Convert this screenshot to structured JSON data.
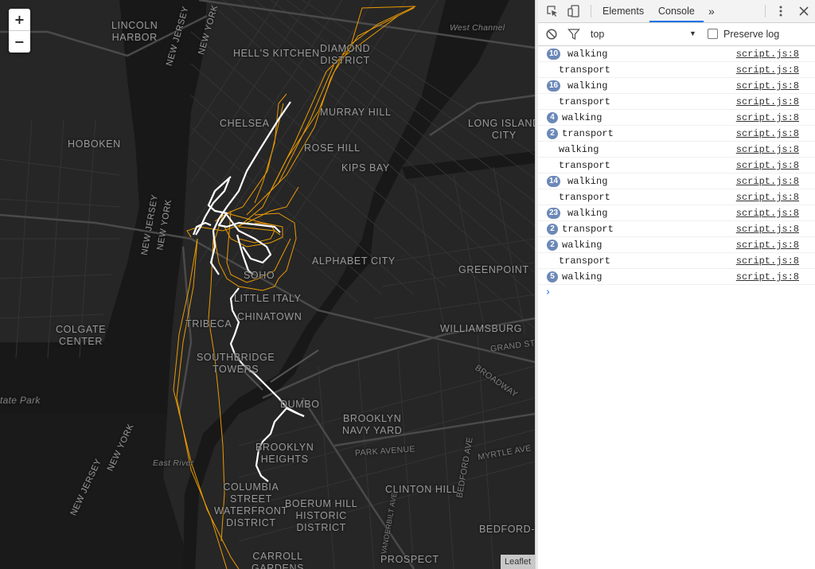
{
  "map": {
    "zoom_in": "+",
    "zoom_out": "−",
    "attribution": "Leaflet",
    "labels": {
      "lincoln_harbor": "LINCOLN\nHARBOR",
      "hells_kitchen": "HELL'S KITCHEN",
      "diamond_district": "DIAMOND\nDISTRICT",
      "murray_hill": "MURRAY HILL",
      "chelsea": "CHELSEA",
      "hoboken": "HOBOKEN",
      "rose_hill": "ROSE HILL",
      "kips_bay": "KIPS BAY",
      "long_island_city": "LONG ISLAND\nCITY",
      "alphabet_city": "ALPHABET CITY",
      "greenpoint": "GREENPOINT",
      "soho": "SOHO",
      "little_italy": "LITTLE ITALY",
      "tribeca": "TRIBECA",
      "chinatown": "CHINATOWN",
      "colgate_center": "COLGATE\nCENTER",
      "williamsburg": "WILLIAMSBURG",
      "southbridge_towers": "SOUTHBRIDGE\nTOWERS",
      "dumbo": "DUMBO",
      "brooklyn_navy_yard": "BROOKLYN\nNAVY YARD",
      "brooklyn_heights": "BROOKLYN\nHEIGHTS",
      "clinton_hill": "CLINTON HILL",
      "columbia_street": "COLUMBIA\nSTREET\nWATERFRONT\nDISTRICT",
      "boerum_hill": "BOERUM HILL\nHISTORIC\nDISTRICT",
      "bedford_s": "BEDFORD-S",
      "carroll_gardens": "CARROLL\nGARDENS",
      "prospect": "PROSPECT",
      "state_park": "tate Park",
      "east_river": "East River",
      "west_channel": "West Channel",
      "new_jersey_1": "NEW JERSEY",
      "new_york_1": "NEW YORK",
      "new_jersey_2": "NEW JERSEY",
      "new_york_2": "NEW YORK",
      "new_jersey_3": "NEW JERSEY",
      "new_york_3": "NEW YORK",
      "grand_st": "GRAND ST",
      "broadway": "BROADWAY",
      "park_avenue": "PARK AVENUE",
      "myrtle_ave": "MYRTLE AVE",
      "bedford_ave": "BEDFORD AVE",
      "vanderbilt": "VANDERBILT AVE"
    },
    "colors": {
      "walking": "#ffffff",
      "transport": "#f5a100",
      "background": "#262626",
      "streets": "#3a3a3a"
    }
  },
  "devtools": {
    "tabs": [
      "Elements",
      "Console"
    ],
    "active_tab": "Console",
    "more_tabs": "»",
    "context": "top",
    "preserve_log": "Preserve log",
    "logs": [
      {
        "count": "10",
        "text": "walking",
        "source": "script.js:8"
      },
      {
        "count": "",
        "text": "transport",
        "source": "script.js:8"
      },
      {
        "count": "16",
        "text": "walking",
        "source": "script.js:8"
      },
      {
        "count": "",
        "text": "transport",
        "source": "script.js:8"
      },
      {
        "count": "4",
        "text": "walking",
        "source": "script.js:8"
      },
      {
        "count": "2",
        "text": "transport",
        "source": "script.js:8"
      },
      {
        "count": "",
        "text": "walking",
        "source": "script.js:8"
      },
      {
        "count": "",
        "text": "transport",
        "source": "script.js:8"
      },
      {
        "count": "14",
        "text": "walking",
        "source": "script.js:8"
      },
      {
        "count": "",
        "text": "transport",
        "source": "script.js:8"
      },
      {
        "count": "23",
        "text": "walking",
        "source": "script.js:8"
      },
      {
        "count": "2",
        "text": "transport",
        "source": "script.js:8"
      },
      {
        "count": "2",
        "text": "walking",
        "source": "script.js:8"
      },
      {
        "count": "",
        "text": "transport",
        "source": "script.js:8"
      },
      {
        "count": "5",
        "text": "walking",
        "source": "script.js:8"
      }
    ],
    "prompt": "›"
  }
}
